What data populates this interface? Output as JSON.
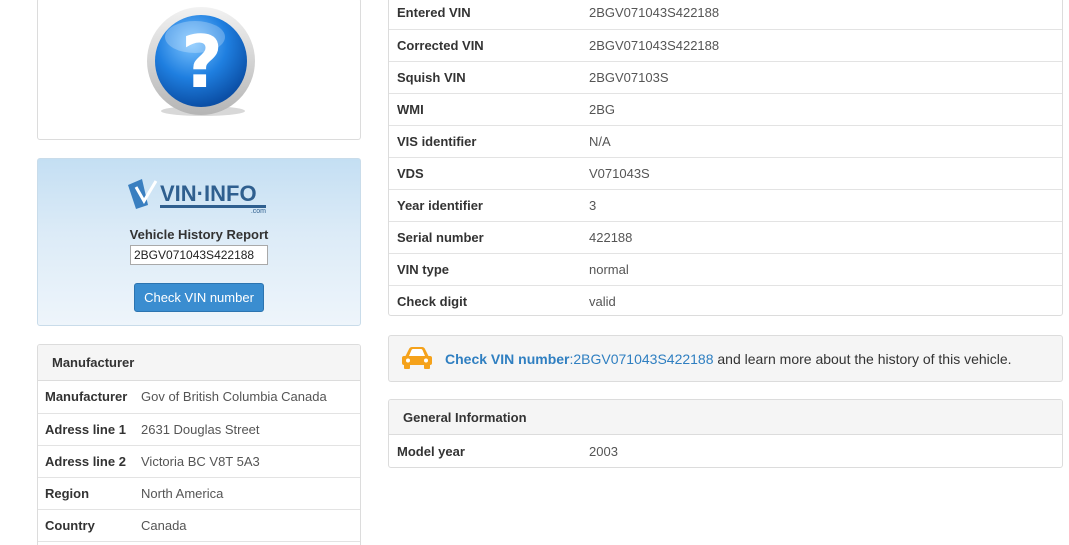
{
  "vin_box": {
    "logo_text": "VIN·INFO",
    "logo_sub": ".com",
    "title": "Vehicle History Report",
    "vin_value": "2BGV071043S422188",
    "button_label": "Check VIN number"
  },
  "manufacturer": {
    "heading": "Manufacturer",
    "rows": [
      {
        "label": "Manufacturer",
        "value": "Gov of British Columbia Canada"
      },
      {
        "label": "Adress line 1",
        "value": "2631 Douglas Street"
      },
      {
        "label": "Adress line 2",
        "value": "Victoria BC V8T 5A3"
      },
      {
        "label": "Region",
        "value": "North America"
      },
      {
        "label": "Country",
        "value": "Canada"
      }
    ]
  },
  "vin_details": {
    "rows": [
      {
        "label": "Entered VIN",
        "value": "2BGV071043S422188"
      },
      {
        "label": "Corrected VIN",
        "value": "2BGV071043S422188"
      },
      {
        "label": "Squish VIN",
        "value": "2BGV07103S"
      },
      {
        "label": "WMI",
        "value": "2BG"
      },
      {
        "label": "VIS identifier",
        "value": "N/A"
      },
      {
        "label": "VDS",
        "value": "V071043S"
      },
      {
        "label": "Year identifier",
        "value": "3"
      },
      {
        "label": "Serial number",
        "value": "422188"
      },
      {
        "label": "VIN type",
        "value": "normal"
      },
      {
        "label": "Check digit",
        "value": "valid"
      }
    ]
  },
  "promo": {
    "link_text": "Check VIN number",
    "vin": ":2BGV071043S422188",
    "suffix": " and learn more about the history of this vehicle.",
    "icon": "car-icon"
  },
  "general_info": {
    "heading": "General Information",
    "rows": [
      {
        "label": "Model year",
        "value": "2003"
      }
    ]
  },
  "colors": {
    "accent_blue": "#3a8dd0",
    "link_blue": "#2f7fc1",
    "car_orange": "#f5a21b"
  }
}
